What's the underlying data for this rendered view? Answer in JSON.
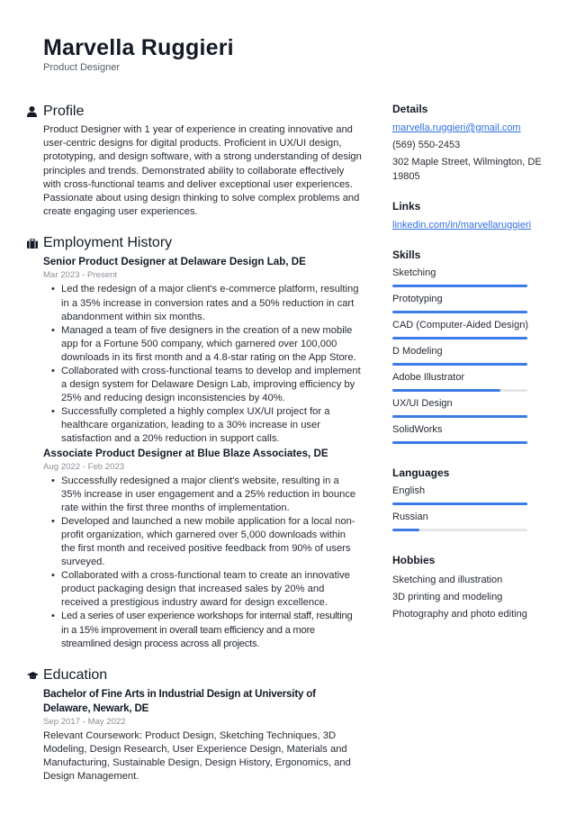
{
  "header": {
    "name": "Marvella Ruggieri",
    "title": "Product Designer"
  },
  "profile": {
    "heading": "Profile",
    "icon": "user-icon",
    "text": "Product Designer with 1 year of experience in creating innovative and user-centric designs for digital products. Proficient in UX/UI design, prototyping, and design software, with a strong understanding of design principles and trends. Demonstrated ability to collaborate effectively with cross-functional teams and deliver exceptional user experiences. Passionate about using design thinking to solve complex problems and create engaging user experiences."
  },
  "employment": {
    "heading": "Employment History",
    "icon": "briefcase-icon",
    "jobs": [
      {
        "title": "Senior Product Designer at Delaware Design Lab, DE",
        "dates": "Mar 2023 - Present",
        "bullets": [
          "Led the redesign of a major client's e-commerce platform, resulting in a 35% increase in conversion rates and a 50% reduction in cart abandonment within six months.",
          "Managed a team of five designers in the creation of a new mobile app for a Fortune 500 company, which garnered over 100,000 downloads in its first month and a 4.8-star rating on the App Store.",
          "Collaborated with cross-functional teams to develop and implement a design system for Delaware Design Lab, improving efficiency by 25% and reducing design inconsistencies by 40%.",
          "Successfully completed a highly complex UX/UI project for a healthcare organization, leading to a 30% increase in user satisfaction and a 20% reduction in support calls."
        ]
      },
      {
        "title": "Associate Product Designer at Blue Blaze Associates, DE",
        "dates": "Aug 2022 - Feb 2023",
        "bullets": [
          "Successfully redesigned a major client's website, resulting in a 35% increase in user engagement and a 25% reduction in bounce rate within the first three months of implementation.",
          "Developed and launched a new mobile application for a local non-profit organization, which garnered over 5,000 downloads within the first month and received positive feedback from 90% of users surveyed.",
          "Collaborated with a cross-functional team to create an innovative product packaging design that increased sales by 20% and received a prestigious industry award for design excellence.",
          "Led a series of user experience workshops for internal staff, resulting in a 15% improvement in overall team efficiency and a more streamlined design process across all projects."
        ]
      }
    ]
  },
  "education": {
    "heading": "Education",
    "icon": "graduation-cap-icon",
    "degree": "Bachelor of Fine Arts in Industrial Design at University of Delaware, Newark, DE",
    "dates": "Sep 2017 - May 2022",
    "text": "Relevant Coursework: Product Design, Sketching Techniques, 3D Modeling, Design Research, User Experience Design, Materials and Manufacturing, Sustainable Design, Design History, Ergonomics, and Design Management."
  },
  "details": {
    "heading": "Details",
    "email": "marvella.ruggieri@gmail.com",
    "phone": "(569) 550-2453",
    "address": "302 Maple Street, Wilmington, DE 19805"
  },
  "links": {
    "heading": "Links",
    "items": [
      "linkedin.com/in/marvellaruggieri"
    ]
  },
  "skills": {
    "heading": "Skills",
    "items": [
      {
        "label": "Sketching",
        "level": 1.0
      },
      {
        "label": "Prototyping",
        "level": 1.0
      },
      {
        "label": "CAD (Computer-Aided Design)",
        "level": 1.0
      },
      {
        "label": "D Modeling",
        "level": 1.0
      },
      {
        "label": "Adobe Illustrator",
        "level": 0.8
      },
      {
        "label": "UX/UI Design",
        "level": 1.0
      },
      {
        "label": "SolidWorks",
        "level": 1.0
      }
    ]
  },
  "languages": {
    "heading": "Languages",
    "items": [
      {
        "label": "English",
        "level": 1.0
      },
      {
        "label": "Russian",
        "level": 0.2
      }
    ]
  },
  "hobbies": {
    "heading": "Hobbies",
    "items": [
      "Sketching and illustration",
      "3D printing and modeling",
      "Photography and photo editing"
    ]
  },
  "colors": {
    "accent": "#3b7be6",
    "link": "#2f6fe0",
    "track": "#e3e5e8"
  }
}
